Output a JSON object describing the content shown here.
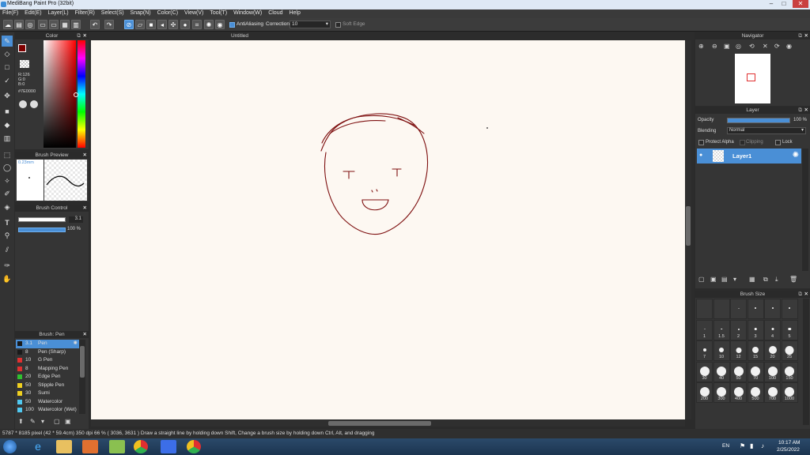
{
  "window": {
    "title": "MediBang Paint Pro (32bit)",
    "minimize": "–",
    "maximize": "□",
    "close": "✕"
  },
  "menu": [
    "File(F)",
    "Edit(E)",
    "Layer(L)",
    "Filter(R)",
    "Select(S)",
    "Snap(N)",
    "Color(C)",
    "View(V)",
    "Tool(T)",
    "Window(W)",
    "Cloud",
    "Help"
  ],
  "toolbar": {
    "antialiasing_label": "AntiAliasing",
    "correction_label": "Correction",
    "correction_value": "10",
    "soft_edge_label": "Soft Edge"
  },
  "color_panel": {
    "title": "Color",
    "r": "R:126",
    "g": "G:0",
    "b": "B:0",
    "hex": "#7E0000",
    "fg_color": "#7e0000",
    "bg_color": "#ffffff"
  },
  "brush_preview": {
    "title": "Brush Preview",
    "size_text": "0.23mm"
  },
  "brush_control": {
    "title": "Brush Control",
    "size_value": "3.1",
    "opacity_value": "100 %"
  },
  "brush_list": {
    "title": "Brush: Pen",
    "items": [
      {
        "size": "3.1",
        "name": "Pen",
        "color": "#1a1a1a"
      },
      {
        "size": "8",
        "name": "Pen (Sharp)",
        "color": "#1a1a1a"
      },
      {
        "size": "10",
        "name": "G Pen",
        "color": "#e03030"
      },
      {
        "size": "8",
        "name": "Mapping Pen",
        "color": "#e03030"
      },
      {
        "size": "20",
        "name": "Edge Pen",
        "color": "#30c030"
      },
      {
        "size": "50",
        "name": "Stipple Pen",
        "color": "#f0d020"
      },
      {
        "size": "30",
        "name": "Sumi",
        "color": "#f0d020"
      },
      {
        "size": "50",
        "name": "Watercolor",
        "color": "#50c8f0"
      },
      {
        "size": "100",
        "name": "Watercolor (Wet)",
        "color": "#50c8f0"
      }
    ]
  },
  "document": {
    "tab": "Untitled"
  },
  "navigator": {
    "title": "Navigator"
  },
  "layer_panel": {
    "title": "Layer",
    "opacity_label": "Opacity",
    "opacity_value": "100 %",
    "opacity_fraction": 1.0,
    "blending_label": "Blending",
    "blending_value": "Normal",
    "protect_alpha": "Protect Alpha",
    "clipping": "Clipping",
    "lock": "Lock",
    "layer_name": "Layer1"
  },
  "brush_size_panel": {
    "title": "Brush Size",
    "sizes": [
      "",
      "",
      "",
      "",
      "",
      "",
      "1",
      "1.5",
      "2",
      "3",
      "4",
      "5",
      "7",
      "10",
      "12",
      "15",
      "20",
      "25",
      "30",
      "40",
      "50",
      "70",
      "100",
      "150",
      "200",
      "300",
      "400",
      "500",
      "700",
      "1000"
    ]
  },
  "status": {
    "text": "5787 * 8185 pixel   (42 * 59.4cm)   350 dpi   66 %   ( 3036, 3631 )   Draw a straight line by holding down Shift, Change a brush size by holding down Ctrl, Alt, and dragging"
  },
  "taskbar": {
    "lang": "EN",
    "time": "10:17 AM",
    "date": "2/25/2022"
  },
  "colors": {
    "accent": "#4a8fd6",
    "stroke": "#7e1010"
  }
}
